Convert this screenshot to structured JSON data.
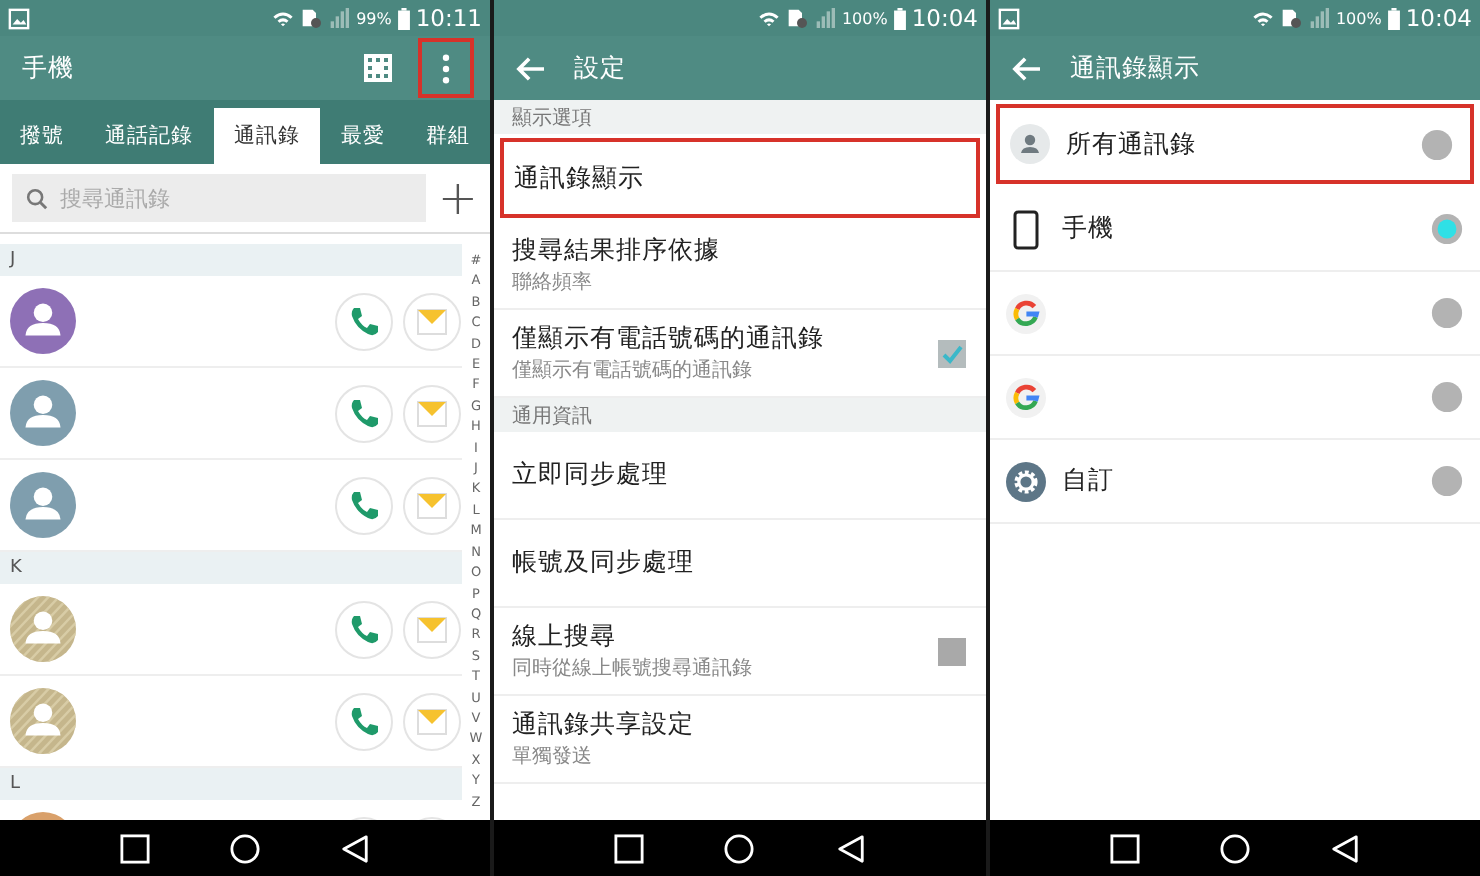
{
  "screens": [
    {
      "kind": "contacts",
      "status_bar": {
        "picture_notification": true,
        "battery": "99%",
        "time": "10:11"
      },
      "app_bar": {
        "title": "手機",
        "back": false,
        "actions": [
          {
            "kind": "dialpad",
            "highlighted": false
          },
          {
            "kind": "menu",
            "highlighted": true
          }
        ]
      },
      "tabs": [
        {
          "label": "撥號",
          "selected": false
        },
        {
          "label": "通話記錄",
          "selected": false
        },
        {
          "label": "通訊錄",
          "selected": true
        },
        {
          "label": "最愛",
          "selected": false
        },
        {
          "label": "群組",
          "selected": false
        }
      ],
      "search": {
        "placeholder": "搜尋通訊錄",
        "add_label": "+"
      },
      "sections": [
        {
          "letter": "J",
          "contacts": [
            {
              "color": "#8e70b6",
              "striped": false
            },
            {
              "color": "#7f9eae",
              "striped": false
            },
            {
              "color": "#7f9eae",
              "striped": false
            }
          ]
        },
        {
          "letter": "K",
          "contacts": [
            {
              "color": "#c5b68c",
              "striped": true
            },
            {
              "color": "#c5b68c",
              "striped": true
            }
          ]
        },
        {
          "letter": "L",
          "contacts": [
            {
              "color": "#d9a06a",
              "striped": false
            }
          ]
        }
      ],
      "index": [
        "#",
        "A",
        "B",
        "C",
        "D",
        "E",
        "F",
        "G",
        "H",
        "I",
        "J",
        "K",
        "L",
        "M",
        "N",
        "O",
        "P",
        "Q",
        "R",
        "S",
        "T",
        "U",
        "V",
        "W",
        "X",
        "Y",
        "Z"
      ]
    },
    {
      "kind": "settings",
      "status_bar": {
        "picture_notification": false,
        "battery": "100%",
        "time": "10:04"
      },
      "app_bar": {
        "title": "設定",
        "back": true
      },
      "items": [
        {
          "kind": "header",
          "title": "顯示選項"
        },
        {
          "kind": "item",
          "title": "通訊錄顯示",
          "highlighted": true
        },
        {
          "kind": "item",
          "title": "搜尋結果排序依據",
          "subtitle": "聯絡頻率",
          "highlighted": false
        },
        {
          "kind": "checkbox",
          "title": "僅顯示有電話號碼的通訊錄",
          "subtitle": "僅顯示有電話號碼的通訊錄",
          "checked": true,
          "highlighted": false
        },
        {
          "kind": "header",
          "title": "通用資訊"
        },
        {
          "kind": "item",
          "title": "立即同步處理",
          "highlighted": false
        },
        {
          "kind": "item",
          "title": "帳號及同步處理",
          "highlighted": false
        },
        {
          "kind": "checkbox",
          "title": "線上搜尋",
          "subtitle": "同時從線上帳號搜尋通訊錄",
          "checked": false,
          "highlighted": false
        },
        {
          "kind": "item",
          "title": "通訊錄共享設定",
          "subtitle": "單獨發送",
          "highlighted": false
        }
      ]
    },
    {
      "kind": "options",
      "status_bar": {
        "picture_notification": true,
        "battery": "100%",
        "time": "10:04"
      },
      "app_bar": {
        "title": "通訊錄顯示",
        "back": true
      },
      "options": [
        {
          "kind": "person",
          "label": "所有通訊錄",
          "selected": false,
          "highlighted": true
        },
        {
          "kind": "phone",
          "label": "手機",
          "selected": true,
          "highlighted": false
        },
        {
          "kind": "google",
          "selected": false,
          "highlighted": false
        },
        {
          "kind": "google",
          "selected": false,
          "highlighted": false
        },
        {
          "kind": "gear",
          "label": "自訂",
          "selected": false,
          "highlighted": false
        }
      ]
    }
  ]
}
